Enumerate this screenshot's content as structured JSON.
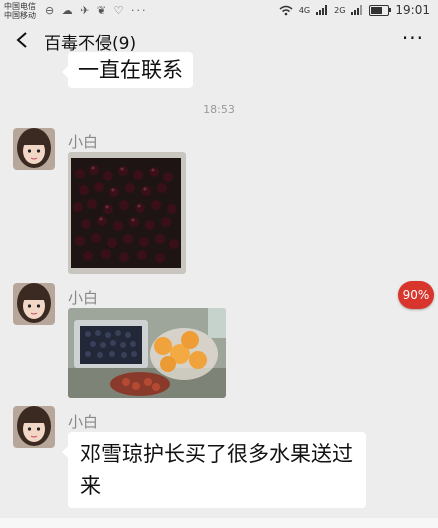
{
  "status_bar": {
    "carrier_line1": "中国电信",
    "carrier_line2": "中国移动",
    "left_icons": "⊖ ☁ ✈ ❦ ♡ ···",
    "network_label": "4G",
    "network_label2": "2G",
    "battery_level": 0.75,
    "time": "19:01"
  },
  "header": {
    "back_icon": "chevron-left-icon",
    "title": "百毒不侵(9)",
    "more_icon": "more-icon",
    "more_label": "···"
  },
  "messages": {
    "prev_bubble_text": "一直在联系",
    "timestamp": "18:53",
    "sender_1": "小白",
    "sender_2": "小白",
    "sender_3": "小白",
    "text_message": "邓雪琼护长买了很多水果送过来"
  },
  "badge": {
    "label": "90%"
  },
  "colors": {
    "background": "#ededed",
    "bubble": "#ffffff",
    "badge": "#d8352d"
  }
}
